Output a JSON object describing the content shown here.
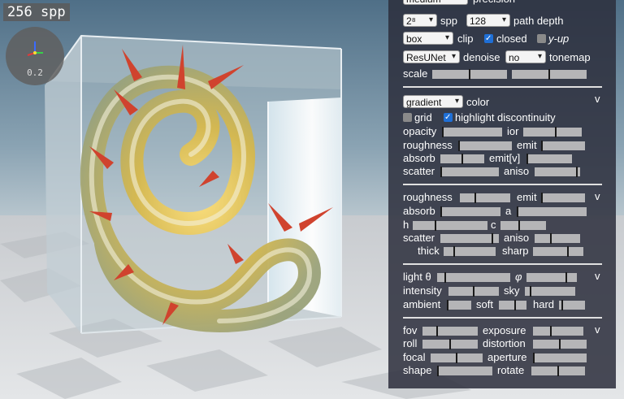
{
  "badge": {
    "spp": "256 spp"
  },
  "gizmo": {
    "value": "0.2"
  },
  "panel": {
    "top_row": {
      "select": "medium",
      "label": "precision"
    },
    "row1": {
      "spp_select": "2⁸",
      "spp_label": "spp",
      "depth_select": "128",
      "depth_label": "path depth"
    },
    "row2": {
      "clip_select": "box",
      "clip_label": "clip",
      "closed_label": "closed",
      "closed_checked": true,
      "yup_label": "y-up",
      "yup_checked": false
    },
    "row3": {
      "denoise_select": "ResUNet",
      "denoise_label": "denoise",
      "tonemap_select": "no",
      "tonemap_label": "tonemap"
    },
    "row4": {
      "scale_label": "scale",
      "scale_a": 0.5,
      "scale_b": 0.5
    },
    "color_section": {
      "collapse": "v",
      "color_select": "gradient",
      "color_label": "color",
      "grid_label": "grid",
      "grid_checked": false,
      "highlight_label": "highlight discontinuity",
      "highlight_checked": true,
      "opacity": {
        "label": "opacity",
        "value": 0.0
      },
      "ior": {
        "label": "ior",
        "value": 0.55
      },
      "roughness": {
        "label": "roughness",
        "value": 0.0
      },
      "emit": {
        "label": "emit",
        "value": 0.0
      },
      "absorb": {
        "label": "absorb",
        "value": 0.5
      },
      "emitv": {
        "label": "emit[v]",
        "value": 0.0
      },
      "scatter": {
        "label": "scatter",
        "value": 0.0
      },
      "aniso": {
        "label": "aniso",
        "value": 0.95
      }
    },
    "material_section": {
      "collapse": "v",
      "roughness": {
        "label": "roughness",
        "value": 0.3
      },
      "emit": {
        "label": "emit",
        "value": 0.0
      },
      "absorb": {
        "label": "absorb",
        "value": 0.0
      },
      "a": {
        "label": "a",
        "value": 0.0
      },
      "h": {
        "label": "h",
        "value": 0.3
      },
      "c": {
        "label": "c",
        "value": 0.4
      },
      "scatter": {
        "label": "scatter",
        "value": 0.9
      },
      "aniso": {
        "label": "aniso",
        "value": 0.35
      },
      "thick": {
        "label": "thick",
        "value": 0.2
      },
      "sharp": {
        "label": "sharp",
        "value": 0.7
      }
    },
    "light_section": {
      "collapse": "v",
      "theta": {
        "label": "light θ",
        "value": 0.1
      },
      "phi": {
        "label": "φ",
        "value": 0.8
      },
      "intensity": {
        "label": "intensity",
        "value": 0.5
      },
      "sky": {
        "label": "sky",
        "value": 0.1
      },
      "ambient": {
        "label": "ambient",
        "value": 0.0
      },
      "soft": {
        "label": "soft",
        "value": 0.6
      },
      "hard": {
        "label": "hard",
        "value": 0.1
      }
    },
    "camera_section": {
      "collapse": "v",
      "fov": {
        "label": "fov",
        "value": 0.25
      },
      "exposure": {
        "label": "exposure",
        "value": 0.35
      },
      "roll": {
        "label": "roll",
        "value": 0.5
      },
      "distortion": {
        "label": "distortion",
        "value": 0.5
      },
      "focal": {
        "label": "focal",
        "value": 0.5
      },
      "aperture": {
        "label": "aperture",
        "value": 0.0
      },
      "shape": {
        "label": "shape",
        "value": 0.0
      },
      "rotate": {
        "label": "rotate",
        "value": 0.5
      }
    }
  }
}
